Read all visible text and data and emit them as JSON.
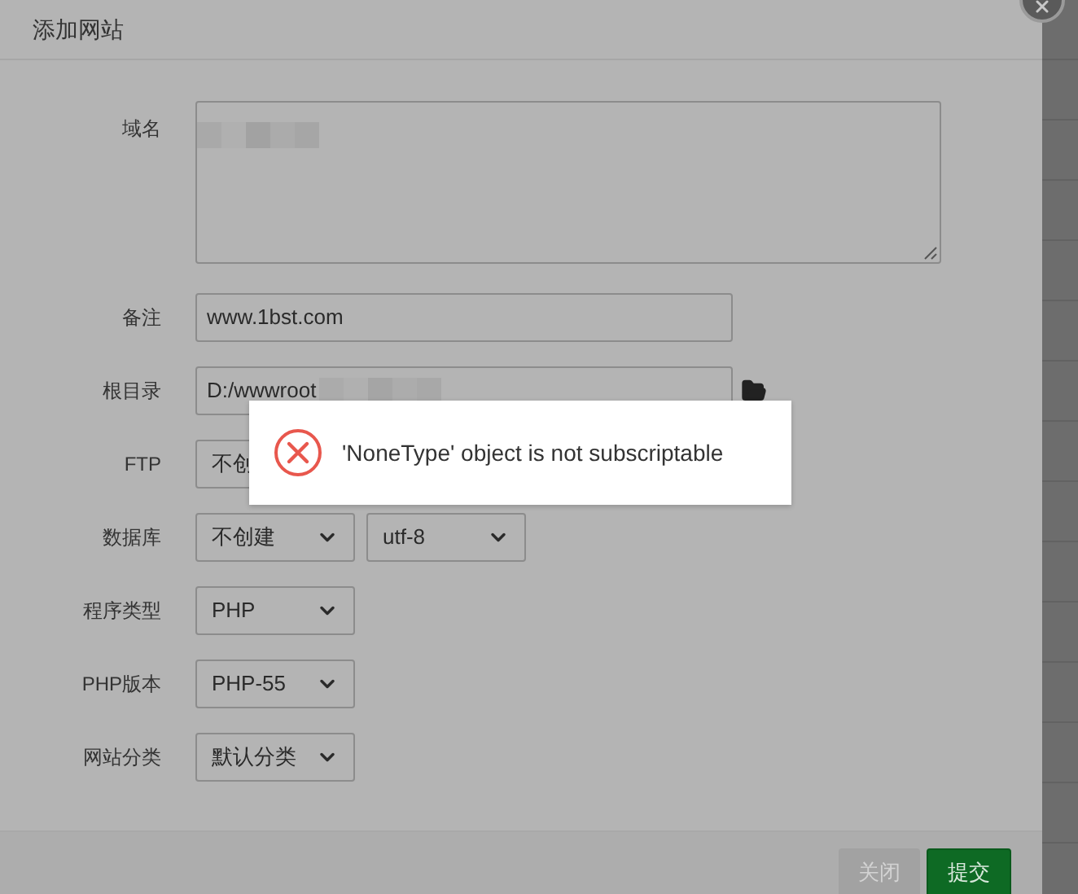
{
  "dialog": {
    "title": "添加网站"
  },
  "fields": [
    {
      "kind": "textarea",
      "label": "域名"
    },
    {
      "kind": "input",
      "label": "备注",
      "value": "www.1bst.com"
    },
    {
      "kind": "path",
      "label": "根目录",
      "value": "D:/wwwroot"
    },
    {
      "kind": "select",
      "label": "FTP",
      "selects": [
        {
          "kind": "cut",
          "value": "不创"
        }
      ]
    },
    {
      "kind": "select",
      "label": "数据库",
      "selects": [
        {
          "kind": "full",
          "value": "不创建"
        },
        {
          "kind": "full",
          "value": "utf-8"
        }
      ]
    },
    {
      "kind": "select",
      "label": "程序类型",
      "selects": [
        {
          "kind": "full",
          "value": "PHP"
        }
      ]
    },
    {
      "kind": "select",
      "label": "PHP版本",
      "selects": [
        {
          "kind": "full",
          "value": "PHP-55"
        }
      ]
    },
    {
      "kind": "select",
      "label": "网站分类",
      "selects": [
        {
          "kind": "full",
          "value": "默认分类"
        }
      ]
    }
  ],
  "buttons": [
    {
      "label": "关闭",
      "kind": "secondary"
    },
    {
      "label": "提交",
      "kind": "primary"
    }
  ],
  "toast": {
    "message": "'NoneType' object is not subscriptable"
  }
}
